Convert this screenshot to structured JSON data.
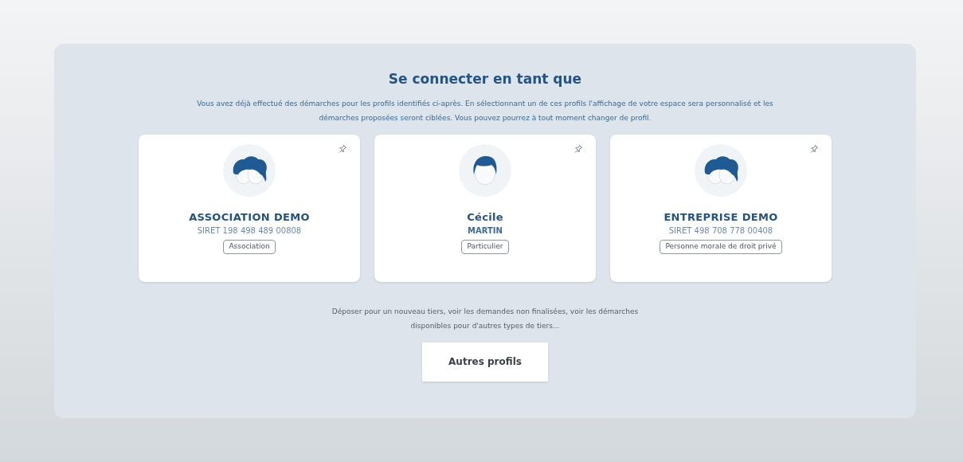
{
  "title": "Se connecter en tant que",
  "intro": "Vous avez déjà effectué des démarches pour les profils identifiés ci-après. En sélectionnant un de ces profils l'affichage de votre espace sera personnalisé et les démarches proposées seront ciblées. Vous pouvez pourrez à tout moment changer de profil.",
  "profiles": [
    {
      "kind": "organisation",
      "name": "ASSOCIATION DEMO",
      "detail": "SIRET 198 498 489 00808",
      "tag": "Association"
    },
    {
      "kind": "person",
      "name": "Cécile",
      "detail": "MARTIN",
      "tag": "Particulier"
    },
    {
      "kind": "organisation",
      "name": "ENTREPRISE DEMO",
      "detail": "SIRET 498 708 778 00408",
      "tag": "Personne morale de droit privé"
    }
  ],
  "other_text": "Déposer pour un nouveau tiers, voir les demandes non finalisées, voir les démarches disponibles pour d'autres types de tiers...",
  "other_button": "Autres profils"
}
